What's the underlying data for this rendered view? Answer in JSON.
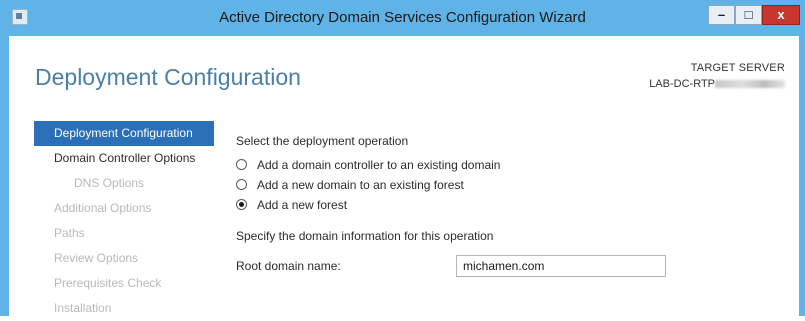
{
  "window": {
    "title": "Active Directory Domain Services Configuration Wizard",
    "controls": {
      "minimize": "–",
      "maximize": "□",
      "close": "x"
    }
  },
  "header": {
    "page_title": "Deployment Configuration",
    "target_server_label": "TARGET SERVER",
    "target_server_value": "LAB-DC-RTP"
  },
  "nav": {
    "items": [
      {
        "label": "Deployment Configuration",
        "state": "active"
      },
      {
        "label": "Domain Controller Options",
        "state": "enabled"
      },
      {
        "label": "DNS Options",
        "state": "disabled"
      },
      {
        "label": "Additional Options",
        "state": "disabled"
      },
      {
        "label": "Paths",
        "state": "disabled"
      },
      {
        "label": "Review Options",
        "state": "disabled"
      },
      {
        "label": "Prerequisites Check",
        "state": "disabled"
      },
      {
        "label": "Installation",
        "state": "disabled"
      }
    ]
  },
  "main": {
    "operation_label": "Select the deployment operation",
    "options": [
      {
        "label": "Add a domain controller to an existing domain",
        "checked": false
      },
      {
        "label": "Add a new domain to an existing forest",
        "checked": false
      },
      {
        "label": "Add a new forest",
        "checked": true
      }
    ],
    "domain_info_label": "Specify the domain information for this operation",
    "root_domain_label": "Root domain name:",
    "root_domain_value": "michamen.com"
  },
  "colors": {
    "titlebar": "#5fb3e6",
    "accent_title": "#4a7fa8",
    "nav_active_bg": "#2a6fb7",
    "close_button": "#c7372f"
  }
}
